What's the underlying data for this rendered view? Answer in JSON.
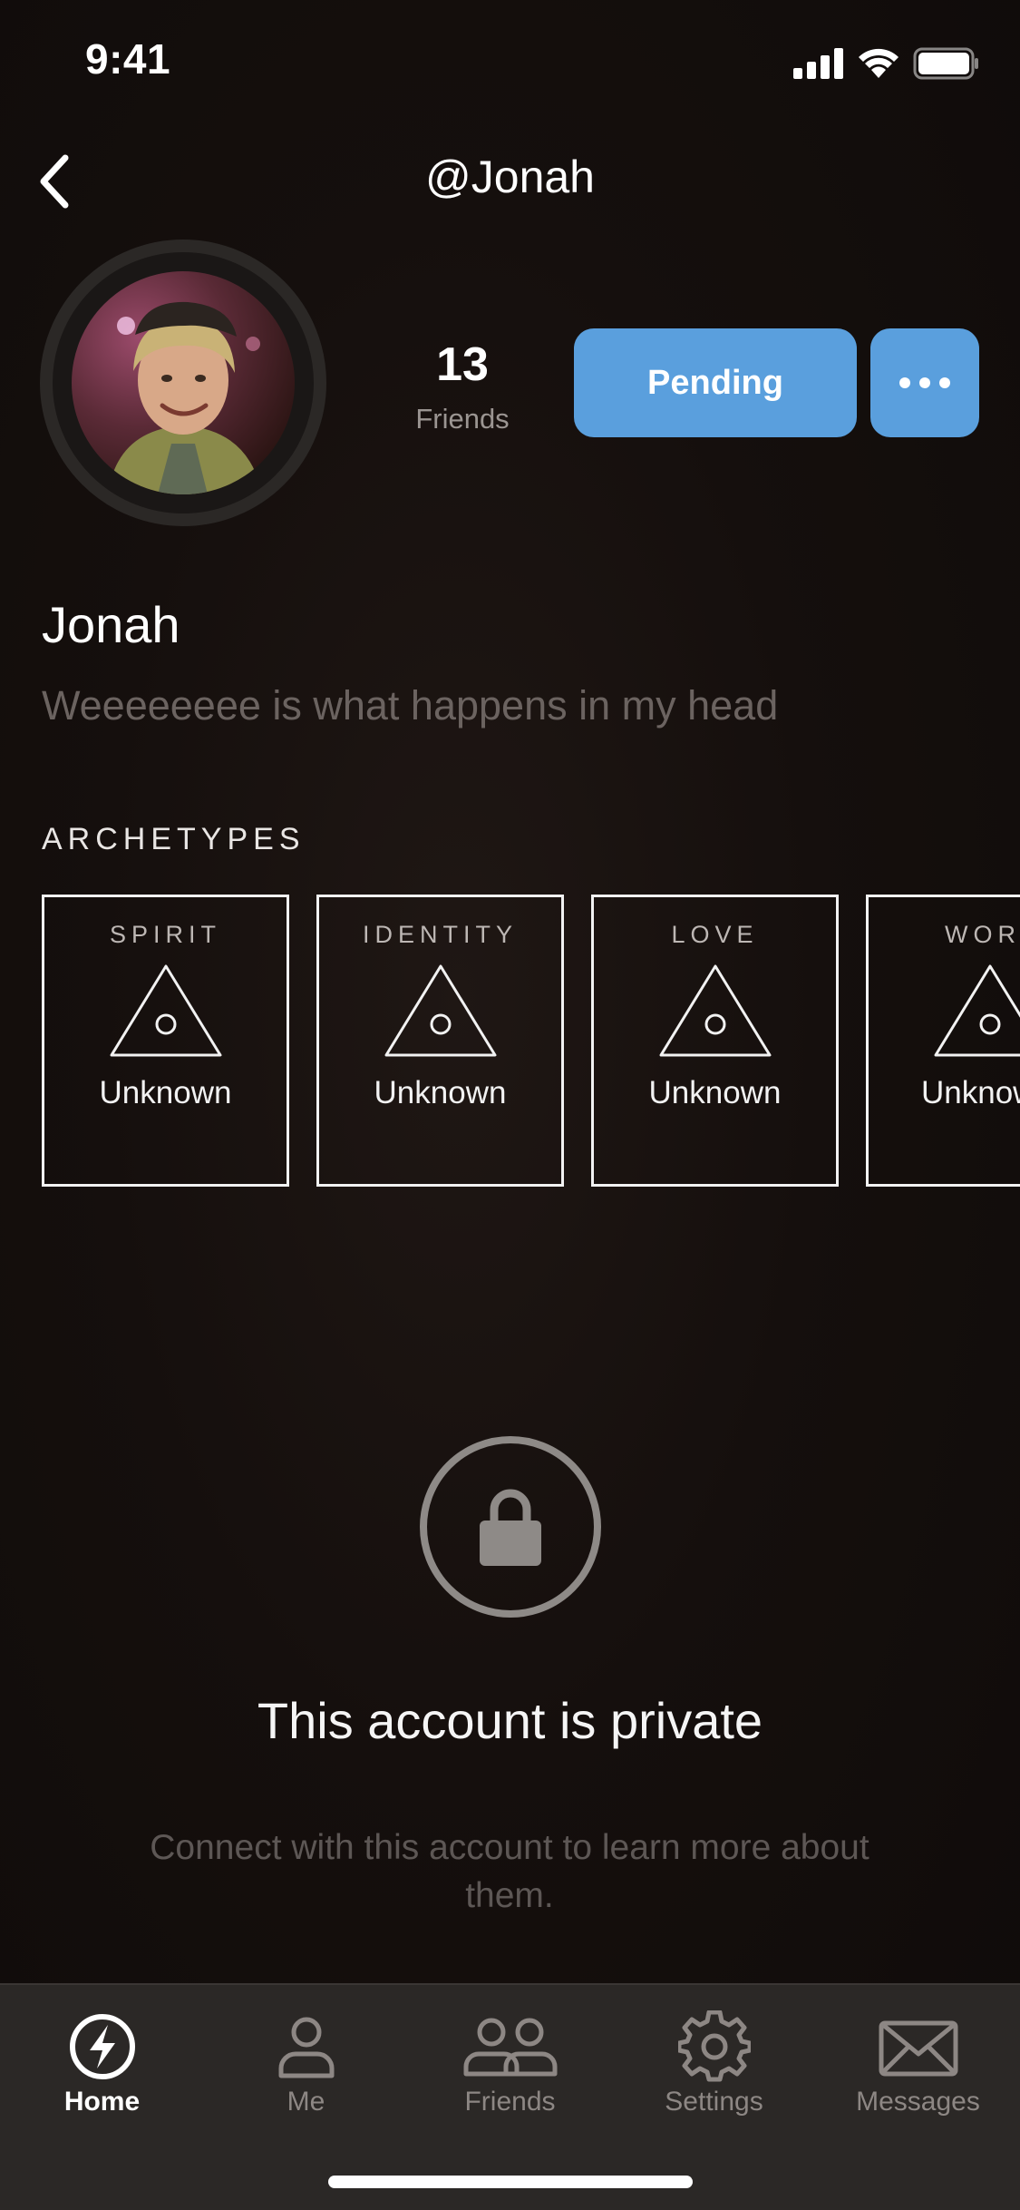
{
  "status_bar": {
    "time": "9:41"
  },
  "header": {
    "title": "@Jonah"
  },
  "profile": {
    "friends_count": "13",
    "friends_label": "Friends",
    "pending_label": "Pending",
    "name": "Jonah",
    "bio": "Weeeeeeee is what happens in my head"
  },
  "archetypes": {
    "heading": "ARCHETYPES",
    "items": [
      {
        "title": "SPIRIT",
        "value": "Unknown"
      },
      {
        "title": "IDENTITY",
        "value": "Unknown"
      },
      {
        "title": "LOVE",
        "value": "Unknown"
      },
      {
        "title": "WOR",
        "value": "Unknow"
      }
    ]
  },
  "private": {
    "title": "This account is private",
    "text": "Connect with this account to learn more about them."
  },
  "tabs": [
    {
      "label": "Home",
      "icon": "lightning-icon",
      "active": true
    },
    {
      "label": "Me",
      "icon": "person-icon",
      "active": false
    },
    {
      "label": "Friends",
      "icon": "people-icon",
      "active": false
    },
    {
      "label": "Settings",
      "icon": "gear-icon",
      "active": false
    },
    {
      "label": "Messages",
      "icon": "envelope-icon",
      "active": false
    }
  ],
  "colors": {
    "accent": "#5a9fdd",
    "background": "#120e0c",
    "tab_bar": "#2b2826"
  }
}
